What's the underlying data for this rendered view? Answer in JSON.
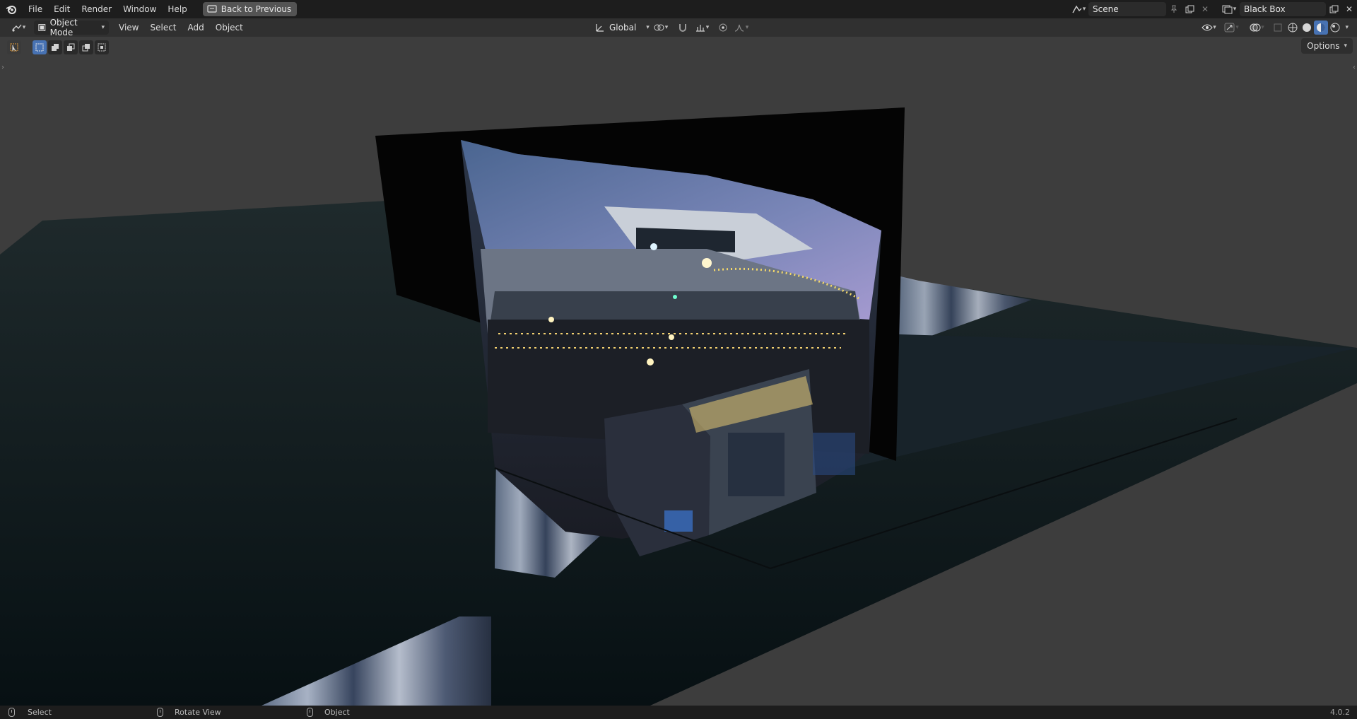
{
  "menu": {
    "file": "File",
    "edit": "Edit",
    "render": "Render",
    "window": "Window",
    "help": "Help",
    "back_button": "Back to Previous"
  },
  "scene": {
    "name": "Scene"
  },
  "view_layer": {
    "name": "Black Box"
  },
  "header": {
    "mode": "Object Mode",
    "view": "View",
    "select": "Select",
    "add": "Add",
    "object": "Object",
    "orientation": "Global"
  },
  "viewport": {
    "options_label": "Options"
  },
  "status": {
    "select": "Select",
    "rotate": "Rotate View",
    "object": "Object",
    "version": "4.0.2"
  },
  "colors": {
    "accent": "#4772b3",
    "viewport_bg": "#3d3d3d",
    "topbar_bg": "#1d1d1d",
    "header_bg": "#303030"
  }
}
